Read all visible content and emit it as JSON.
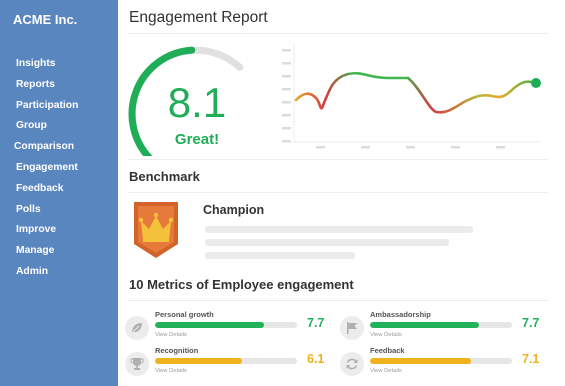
{
  "sidebar": {
    "brand": "ACME Inc.",
    "items": [
      {
        "label": "Insights"
      },
      {
        "label": "Reports"
      },
      {
        "label": "Participation"
      },
      {
        "label": "Group"
      },
      {
        "label": "Comparison"
      },
      {
        "label": "Engagement"
      },
      {
        "label": "Feedback"
      },
      {
        "label": "Polls"
      },
      {
        "label": "Improve"
      },
      {
        "label": "Manage"
      },
      {
        "label": "Admin"
      }
    ]
  },
  "main": {
    "title": "Engagement Report",
    "score": {
      "value": "8.1",
      "word": "Great!",
      "fraction": 0.81
    },
    "benchmark": {
      "title": "Benchmark",
      "name": "Champion",
      "icon": "crown-icon"
    },
    "metrics_title": "10 Metrics of Employee engagement",
    "metrics": [
      {
        "label": "Personal growth",
        "value": "7.7",
        "fraction": 0.77,
        "color": "#22b25c",
        "icon": "leaf-icon",
        "link": "View Details"
      },
      {
        "label": "Ambassadorship",
        "value": "7.7",
        "fraction": 0.77,
        "color": "#22b25c",
        "icon": "flag-icon",
        "link": "View Details"
      },
      {
        "label": "Recognition",
        "value": "6.1",
        "fraction": 0.61,
        "color": "#efb21c",
        "icon": "trophy-icon",
        "link": "View Details"
      },
      {
        "label": "Feedback",
        "value": "7.1",
        "fraction": 0.71,
        "color": "#efb21c",
        "icon": "refresh-icon",
        "link": "View Details"
      }
    ]
  },
  "colors": {
    "sidebar": "#5a86c0",
    "good": "#1fae57",
    "ok": "#efb21c",
    "low": "#d8314f",
    "track": "#e0e0e0"
  }
}
